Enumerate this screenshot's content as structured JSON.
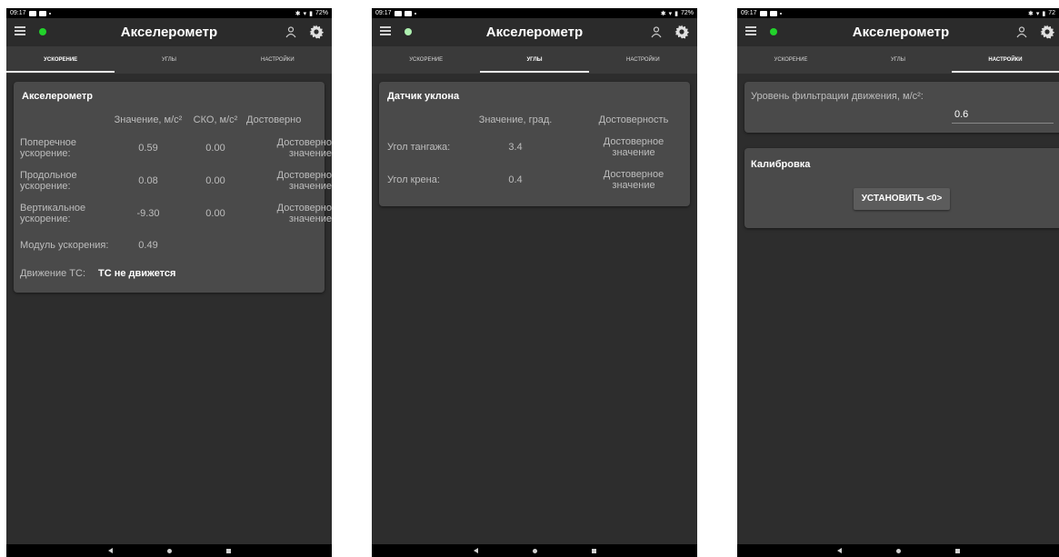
{
  "status_bar": {
    "time": "09:17",
    "battery": "72%",
    "battery_cut": "72"
  },
  "app": {
    "title": "Акселерометр",
    "led_color": "#22d22b",
    "led_color_dim": "#aef0b0"
  },
  "tabs": [
    "УСКОРЕНИЕ",
    "УГЛЫ",
    "НАСТРОЙКИ"
  ],
  "screen1": {
    "card_title": "Акселерометр",
    "headers": {
      "value": "Значение, м/с²",
      "sko": "СКО, м/с²",
      "validity": "Достоверно"
    },
    "rows": [
      {
        "label": "Поперечное ускорение:",
        "value": "0.59",
        "sko": "0.00",
        "validity": "Достоверно значение"
      },
      {
        "label": "Продольное ускорение:",
        "value": "0.08",
        "sko": "0.00",
        "validity": "Достоверно значение"
      },
      {
        "label": "Вертикальное ускорение:",
        "value": "-9.30",
        "sko": "0.00",
        "validity": "Достоверно значение"
      }
    ],
    "module_label": "Модуль ускорения:",
    "module_value": "0.49",
    "motion_label": "Движение ТС:",
    "motion_value": "ТС не движется"
  },
  "screen2": {
    "card_title": "Датчик уклона",
    "headers": {
      "value": "Значение, град.",
      "validity": "Достоверность"
    },
    "rows": [
      {
        "label": "Угол тангажа:",
        "value": "3.4",
        "validity": "Достоверное значение"
      },
      {
        "label": "Угол крена:",
        "value": "0.4",
        "validity": "Достоверное значение"
      }
    ]
  },
  "screen3": {
    "filter_label": "Уровень фильтрации движения, м/с²:",
    "filter_value": "0.6",
    "calib_title": "Калибровка",
    "set_button": "УСТАНОВИТЬ <0>"
  }
}
